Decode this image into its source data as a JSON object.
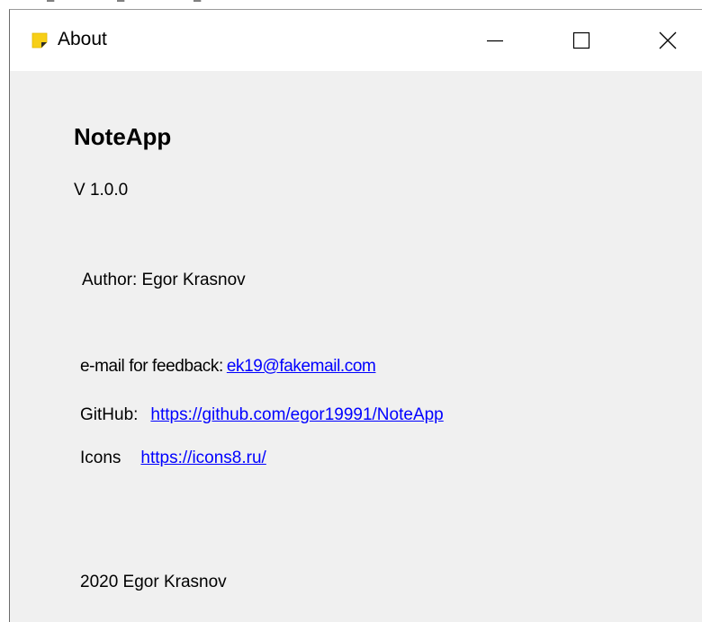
{
  "window": {
    "title": "About",
    "icon": "sticky-note-icon",
    "accent_color": "#f7cf17"
  },
  "caption_buttons": {
    "minimize_icon": "minimize-icon",
    "maximize_icon": "maximize-icon",
    "close_icon": "close-icon"
  },
  "about": {
    "app_name": "NoteApp",
    "version": "V 1.0.0",
    "author": "Author: Egor Krasnov",
    "email_label": "e-mail for feedback:",
    "email": "ek19@fakemail.com",
    "github_label": "GitHub:",
    "github_url": "https://github.com/egor19991/NoteApp",
    "icons_label": "Icons",
    "icons_url": "https://icons8.ru/",
    "copyright": "2020 Egor Krasnov",
    "link_color": "#0000ff"
  }
}
